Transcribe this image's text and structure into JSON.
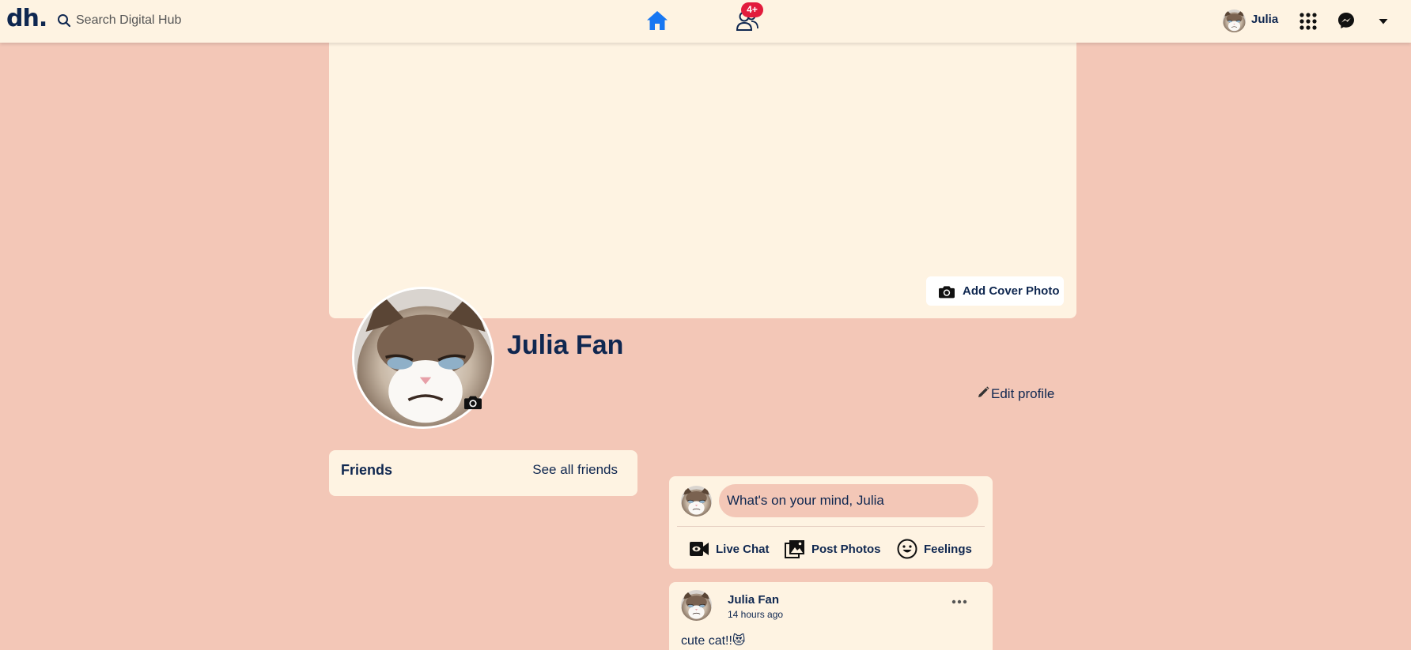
{
  "app": {
    "logo": "dh."
  },
  "search": {
    "placeholder": "Search Digital Hub"
  },
  "nav": {
    "home_icon": "home-icon",
    "friends_icon": "friends-icon",
    "friends_badge": "4+"
  },
  "user": {
    "name": "Julia"
  },
  "colors": {
    "background": "#f3c7b7",
    "card": "#fef3e2",
    "text": "#0f2750",
    "accent": "#1877f2",
    "badge": "#e21b3c"
  },
  "cover": {
    "add_cover_label": "Add Cover Photo"
  },
  "profile": {
    "name": "Julia Fan",
    "edit_label": "Edit profile"
  },
  "friends": {
    "title": "Friends",
    "see_all_label": "See all friends"
  },
  "composer": {
    "placeholder": "What's on your mind, Julia",
    "actions": [
      {
        "label": "Live Chat",
        "icon": "video-icon"
      },
      {
        "label": "Post Photos",
        "icon": "photos-icon"
      },
      {
        "label": "Feelings",
        "icon": "smile-icon"
      }
    ]
  },
  "post": {
    "author": "Julia Fan",
    "time": "14 hours ago",
    "text": "cute cat!!😻"
  }
}
